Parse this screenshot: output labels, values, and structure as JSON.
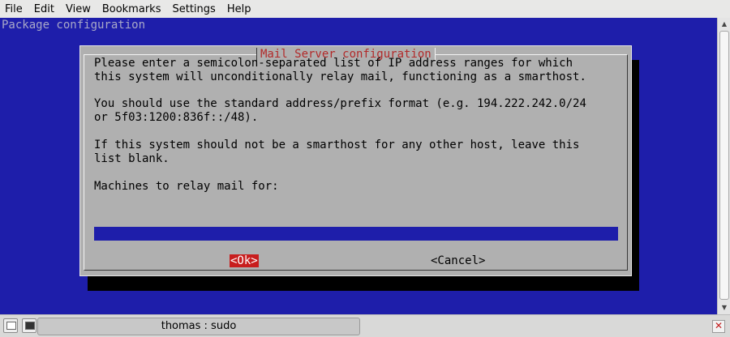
{
  "menubar": {
    "items": [
      {
        "label": "File"
      },
      {
        "label": "Edit"
      },
      {
        "label": "View"
      },
      {
        "label": "Bookmarks"
      },
      {
        "label": "Settings"
      },
      {
        "label": "Help"
      }
    ]
  },
  "terminal": {
    "backtitle": "Package configuration",
    "background_color": "#1e1eaa",
    "dialog": {
      "title": "Mail Server configuration",
      "lines": [
        "Please enter a semicolon-separated list of IP address ranges for which",
        "this system will unconditionally relay mail, functioning as a smarthost.",
        "You should use the standard address/prefix format (e.g. 194.222.242.0/24",
        "or 5f03:1200:836f::/48).",
        "If this system should not be a smarthost for any other host, leave this",
        "list blank."
      ],
      "prompt": "Machines to relay mail for:",
      "input_value": "",
      "ok_label": "<Ok>",
      "cancel_label": "<Cancel>"
    }
  },
  "taskbar": {
    "task_title": "thomas : sudo",
    "close_glyph": "✕",
    "icons": [
      "window-list-icon",
      "terminal-icon",
      "close-icon"
    ]
  },
  "scrollbar": {
    "up_glyph": "▲",
    "down_glyph": "▼"
  }
}
